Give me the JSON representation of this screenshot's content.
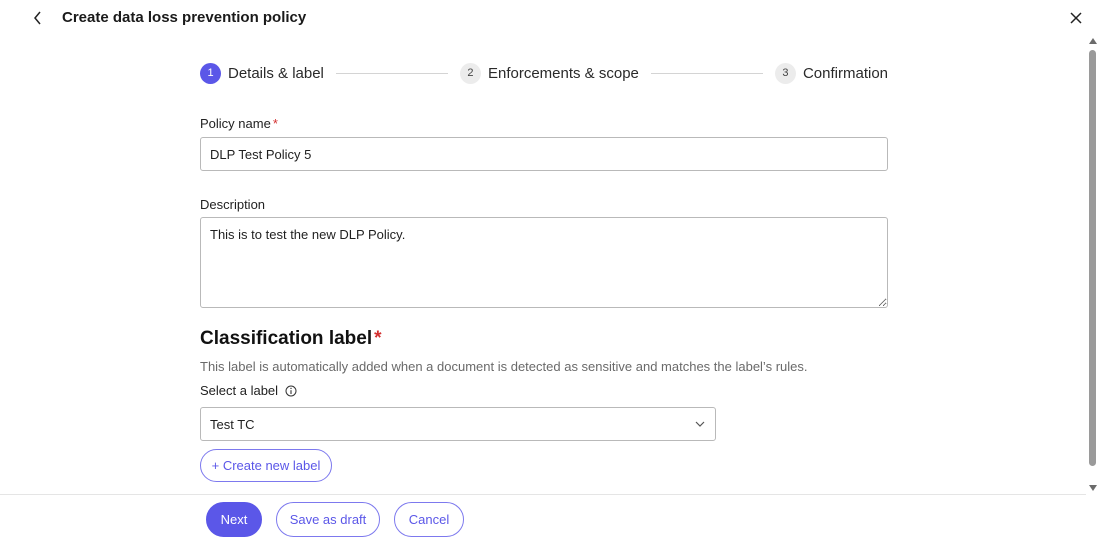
{
  "header": {
    "title": "Create data loss prevention policy"
  },
  "stepper": {
    "steps": [
      {
        "number": "1",
        "label": "Details & label",
        "active": true
      },
      {
        "number": "2",
        "label": "Enforcements & scope",
        "active": false
      },
      {
        "number": "3",
        "label": "Confirmation",
        "active": false
      }
    ]
  },
  "form": {
    "policy_name": {
      "label": "Policy name",
      "required_mark": "*",
      "value": "DLP Test Policy 5"
    },
    "description": {
      "label": "Description",
      "value": "This is to test the new DLP Policy."
    },
    "classification": {
      "title": "Classification label",
      "required_mark": "*",
      "description": "This label is automatically added when a document is detected as sensitive and matches the label’s rules.",
      "select_label": "Select a label",
      "selected_value": "Test TC",
      "create_button": "+ Create new label"
    }
  },
  "footer": {
    "next_label": "Next",
    "draft_label": "Save as draft",
    "cancel_label": "Cancel"
  },
  "colors": {
    "accent": "#5b57e8",
    "required": "#d32f2f",
    "muted_text": "#6a6a6a",
    "border": "#b9b9b9"
  },
  "icons": {
    "back": "chevron-left-icon",
    "close": "close-icon",
    "info": "info-icon",
    "dropdown": "chevron-down-icon"
  }
}
